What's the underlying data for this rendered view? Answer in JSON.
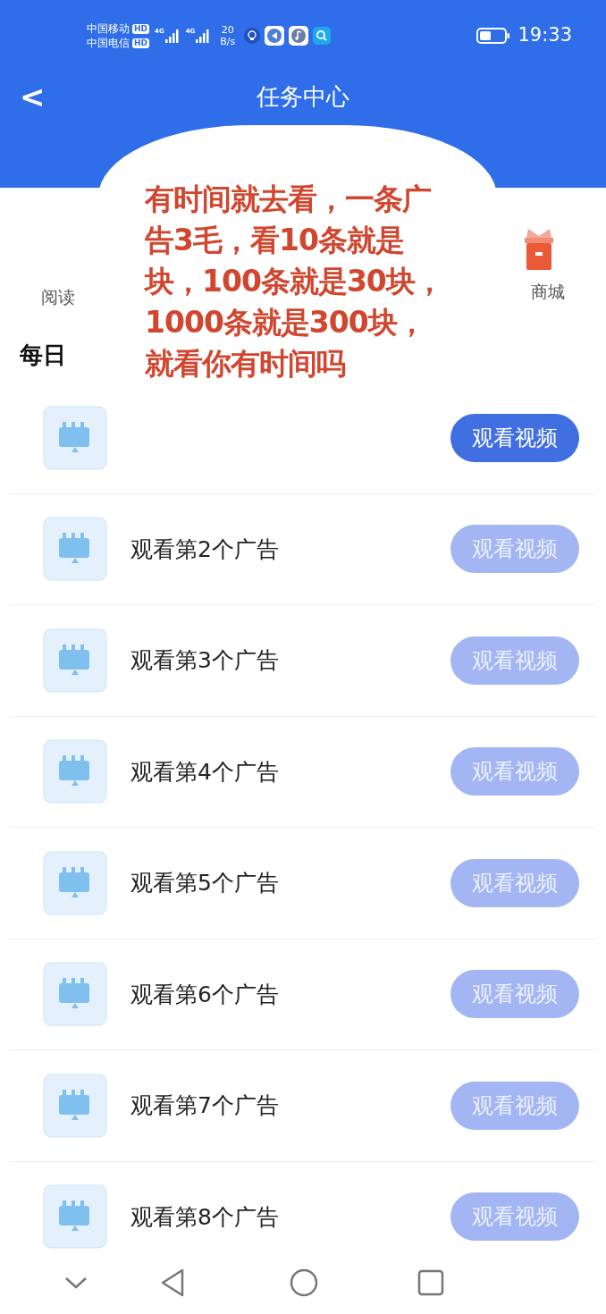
{
  "status_bar": {
    "carriers": [
      {
        "name": "中国移动",
        "badge": "HD"
      },
      {
        "name": "中国电信",
        "badge": "HD"
      }
    ],
    "signals": [
      {
        "label": "4G"
      },
      {
        "label": "4G"
      }
    ],
    "speed_value": "20",
    "speed_unit": "B/s",
    "time": "19:33"
  },
  "header": {
    "back": "<",
    "title": "任务中心"
  },
  "shortcuts": [
    {
      "label": "阅读",
      "kind": "text"
    },
    {
      "label": "商城",
      "kind": "gift"
    }
  ],
  "section_title": "每日",
  "note": "有时间就去看，一条广告3毛，看10条就是块，100条就是30块，1000条就是300块，就看你有时间吗",
  "tasks": [
    {
      "button": "观看视频",
      "disabled": false
    },
    {
      "title": "观看第2个广告",
      "button": "观看视频",
      "disabled": true
    },
    {
      "title": "观看第3个广告",
      "button": "观看视频",
      "disabled": true
    },
    {
      "title": "观看第4个广告",
      "button": "观看视频",
      "disabled": true
    },
    {
      "title": "观看第5个广告",
      "button": "观看视频",
      "disabled": true
    },
    {
      "title": "观看第6个广告",
      "button": "观看视频",
      "disabled": true
    },
    {
      "title": "观看第7个广告",
      "button": "观看视频",
      "disabled": true
    },
    {
      "title": "观看第8个广告",
      "button": "观看视频",
      "disabled": true
    }
  ]
}
